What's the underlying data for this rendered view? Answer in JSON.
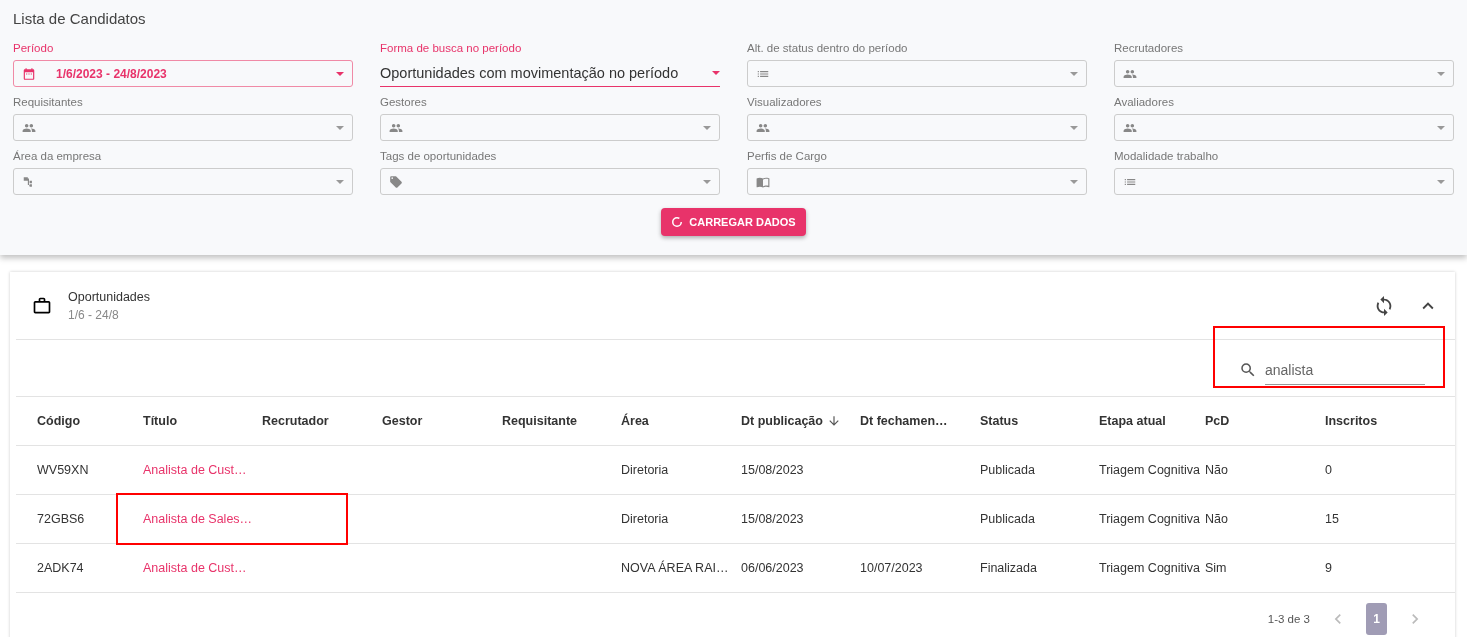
{
  "page_title": "Lista de Candidatos",
  "filters": [
    {
      "label": "Período",
      "kind": "date-range",
      "value": "1/6/2023 - 24/8/2023",
      "active": true
    },
    {
      "label": "Forma de busca no período",
      "kind": "underline-select",
      "value": "Oportunidades com movimentação no período",
      "active": true
    },
    {
      "label": "Alt. de status dentro do período",
      "kind": "outlined",
      "active": false
    },
    {
      "label": "Recrutadores",
      "kind": "outlined",
      "active": false
    },
    {
      "label": "Requisitantes",
      "kind": "outlined",
      "active": false
    },
    {
      "label": "Gestores",
      "kind": "outlined",
      "active": false
    },
    {
      "label": "Visualizadores",
      "kind": "outlined",
      "active": false
    },
    {
      "label": "Avaliadores",
      "kind": "outlined",
      "active": false
    },
    {
      "label": "Área da empresa",
      "kind": "outlined",
      "active": false
    },
    {
      "label": "Tags de oportunidades",
      "kind": "outlined",
      "active": false
    },
    {
      "label": "Perfis de Cargo",
      "kind": "outlined",
      "active": false
    },
    {
      "label": "Modalidade trabalho",
      "kind": "outlined",
      "active": false
    }
  ],
  "load_button": "CARREGAR DADOS",
  "card": {
    "title": "Oportunidades",
    "subtitle": "1/6 - 24/8"
  },
  "search": {
    "value": "analista",
    "highlighted": true
  },
  "table": {
    "columns": [
      {
        "label": "Código",
        "sorted": false
      },
      {
        "label": "Título",
        "sorted": false
      },
      {
        "label": "Recrutador",
        "sorted": false
      },
      {
        "label": "Gestor",
        "sorted": false
      },
      {
        "label": "Requisitante",
        "sorted": false
      },
      {
        "label": "Área",
        "sorted": false
      },
      {
        "label": "Dt publicação",
        "sorted": true
      },
      {
        "label": "Dt fechamen…",
        "sorted": false
      },
      {
        "label": "Status",
        "sorted": false
      },
      {
        "label": "Etapa atual",
        "sorted": false
      },
      {
        "label": "PcD",
        "sorted": false
      },
      {
        "label": "Inscritos",
        "sorted": false
      }
    ],
    "rows": [
      {
        "highlighted": false,
        "cells": [
          "WV59XN",
          "Analista de Cust…",
          "",
          "",
          "",
          "Diretoria",
          "15/08/2023",
          "",
          "Publicada",
          "Triagem Cognitiva",
          "Não",
          "0"
        ]
      },
      {
        "highlighted": true,
        "cells": [
          "72GBS6",
          "Analista de Sales…",
          "",
          "",
          "",
          "Diretoria",
          "15/08/2023",
          "",
          "Publicada",
          "Triagem Cognitiva",
          "Não",
          "15"
        ]
      },
      {
        "highlighted": false,
        "cells": [
          "2ADK74",
          "Analista de Cust…",
          "",
          "",
          "",
          "NOVA ÁREA RAI…",
          "06/06/2023",
          "10/07/2023",
          "Finalizada",
          "Triagem Cognitiva",
          "Sim",
          "9"
        ]
      }
    ]
  },
  "pagination": {
    "range": "1-3 de 3",
    "pages": [
      {
        "label": "1",
        "selected": true
      }
    ]
  }
}
